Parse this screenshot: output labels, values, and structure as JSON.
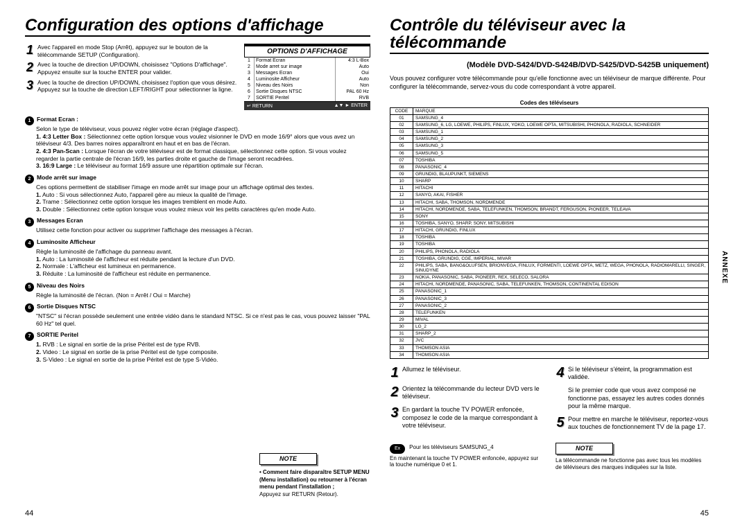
{
  "annexe": "ANNEXE",
  "pages": {
    "left": "44",
    "right": "45"
  },
  "left": {
    "title": "Configuration des options d'affichage",
    "steps": [
      "Avec l'appareil en mode Stop (Arrêt), appuyez sur le bouton de la télécommande SETUP (Configuration).",
      "Avec la touche de direction UP/DOWN, choisissez \"Options D'affichage\". Appuyez ensuite sur la touche ENTER pour valider.",
      "Avec la touche de direction UP/DOWN, choisissez l'option que vous désirez. Appuyez sur la touche de direction LEFT/RIGHT pour sélectionner la ligne."
    ],
    "panel": {
      "title": "OPTIONS D'AFFICHAGE",
      "rows": [
        {
          "n": "1",
          "label": "Format Ecran",
          "val": "4:3  L-Box"
        },
        {
          "n": "2",
          "label": "Mode arret sur image",
          "val": "Auto"
        },
        {
          "n": "3",
          "label": "Messages Ecran",
          "val": "Oui"
        },
        {
          "n": "4",
          "label": "Luminosite Afficheur",
          "val": "Auto"
        },
        {
          "n": "5",
          "label": "Niveau des Noirs",
          "val": "Non"
        },
        {
          "n": "6",
          "label": "Sortie Disques NTSC",
          "val": "PAL 60 Hz"
        },
        {
          "n": "7",
          "label": "SORTIE Peritel",
          "val": "RVB"
        }
      ],
      "ftr_left": "RETURN",
      "ftr_right": "ENTER"
    },
    "details": [
      {
        "n": "1",
        "title": "Format Ecran :",
        "body": "Selon le type de téléviseur, vous pouvez régler votre écran (réglage d'aspect).",
        "items": [
          {
            "h": "1. 4:3 Letter Box :",
            "t": "Sélectionnez cette option lorsque vous voulez visionner le DVD en mode 16/9° alors que vous avez un téléviseur 4/3. Des barres noires apparaîtront en haut et en bas de l'écran."
          },
          {
            "h": "2. 4:3 Pan-Scan :",
            "t": "Lorsque l'écran de votre téléviseur est de format classique, sélectionnez cette option. Si vous voulez regarder la partie centrale de l'écran 16/9, les parties droite et gauche de l'image seront recadrées."
          },
          {
            "h": "3. 16:9 Large :",
            "t": "Le téléviseur au format 16/9 assure une répartition optimale sur l'écran."
          }
        ]
      },
      {
        "n": "2",
        "title": "Mode arrêt sur image",
        "body": "Ces options permettent de stabiliser l'image en mode arrêt sur image pour un affichage optimal des textes.",
        "items": [
          {
            "h": "1.",
            "t": "Auto : Si vous sélectionnez Auto, l'appareil gère au mieux la qualité de l'image."
          },
          {
            "h": "2.",
            "t": "Trame : Sélectionnez cette option lorsque les images tremblent en mode Auto."
          },
          {
            "h": "3.",
            "t": "Double : Sélectionnez cette option lorsque vous voulez mieux voir les petits caractères qu'en mode Auto."
          }
        ]
      },
      {
        "n": "3",
        "title": "Messages Ecran",
        "body": "Utilisez cette fonction pour activer ou supprimer l'affichage des messages à l'écran."
      },
      {
        "n": "4",
        "title": "Luminosite Afficheur",
        "body": "Règle la luminosité de l'affichage du panneau avant.",
        "items": [
          {
            "h": "1.",
            "t": "Auto : La luminosité de l'afficheur est réduite pendant la lecture d'un DVD."
          },
          {
            "h": "2.",
            "t": "Normale : L'afficheur est lumineux en permanence."
          },
          {
            "h": "3.",
            "t": "Réduite : La luminosité de l'afficheur est réduite en permanence."
          }
        ]
      },
      {
        "n": "5",
        "title": "Niveau des Noirs",
        "body": "Règle la luminosité de l'écran. (Non = Arrêt / Oui = Marche)"
      },
      {
        "n": "6",
        "title": "Sortie Disques NTSC",
        "body": "\"NTSC\" si l'écran possède seulement une entrée vidéo dans le standard NTSC. Si ce n'est pas le cas, vous pouvez laisser \"PAL 60 Hz\" tel quel."
      },
      {
        "n": "7",
        "title": "SORTIE Peritel",
        "items": [
          {
            "h": "1.",
            "t": "RVB : Le signal en sortie de la prise Péritel est de type RVB."
          },
          {
            "h": "2.",
            "t": "Video : Le signal en sortie de la prise Péritel est de type composite."
          },
          {
            "h": "3.",
            "t": "S-Video : Le signal en sortie de la prise Péritel est de type S-Vidéo."
          }
        ]
      }
    ],
    "note": {
      "label": "NOTE",
      "body": "• Comment faire disparaître SETUP MENU (Menu installation) ou retourner à l'écran menu pendant l'installation ;",
      "tail": "Appuyez sur RETURN (Retour)."
    }
  },
  "right": {
    "title": "Contrôle du téléviseur avec la télécommande",
    "model": "(Modèle DVD-S424/DVD-S424B/DVD-S425/DVD-S425B uniquement)",
    "intro": "Vous pouvez configurer votre télécommande pour qu'elle fonctionne avec un téléviseur de marque différente. Pour configurer la télécommande, servez-vous du code correspondant à votre appareil.",
    "codes_title": "Codes des téléviseurs",
    "code_hdr": "CODE",
    "brand_hdr": "MARQUE",
    "codes": [
      {
        "c": "01",
        "m": "SAMSUNG_4"
      },
      {
        "c": "02",
        "m": "SAMSUNG_6, LG, LOEWE, PHILIPS, FINLUX, YOKO, LOEWE OPTA, MITSUBISHI, PHONOLA, RADIOLA, SCHNEIDER"
      },
      {
        "c": "03",
        "m": "SAMSUNG_1"
      },
      {
        "c": "04",
        "m": "SAMSUNG_2"
      },
      {
        "c": "05",
        "m": "SAMSUNG_3"
      },
      {
        "c": "06",
        "m": "SAMSUNG_5"
      },
      {
        "c": "07",
        "m": "TOSHIBA"
      },
      {
        "c": "08",
        "m": "PANASONIC_4"
      },
      {
        "c": "09",
        "m": "GRUNDIG, BLAUPUNKT, SIEMENS"
      },
      {
        "c": "10",
        "m": "SHARP"
      },
      {
        "c": "11",
        "m": "HITACHI"
      },
      {
        "c": "12",
        "m": "SANYO, AKAI, FISHER"
      },
      {
        "c": "13",
        "m": "HITACHI, SABA, THOMSON, NORDMENDE"
      },
      {
        "c": "14",
        "m": "HITACHI, NORDMENDE, SABA, TELEFUNKEN, THOMSON, BRANDT, FERGUSON, PIONEER, TELEAVA"
      },
      {
        "c": "15",
        "m": "SONY"
      },
      {
        "c": "16",
        "m": "TOSHIBA, SANYO, SHARP, SONY, MITSUBISHI"
      },
      {
        "c": "17",
        "m": "HITACHI, GRUNDIG, FINLUX"
      },
      {
        "c": "18",
        "m": "TOSHIBA"
      },
      {
        "c": "19",
        "m": "TOSHIBA"
      },
      {
        "c": "20",
        "m": "PHILIPS, PHONOLA, RADIOLA"
      },
      {
        "c": "21",
        "m": "TOSHIBA, GRUNDIG, CGE, IMPERIAL, MIVAR"
      },
      {
        "c": "22",
        "m": "PHILIPS, SABA, BANG&OLUFSEN, BRIONVEGA, FINLUX, FORMENTI, LOEWE OPTA, METZ, WEGA, PHONOLA, RADIOMARELLI, SINGER, SINUDYNE"
      },
      {
        "c": "23",
        "m": "NOKIA, PANASONIC, SABA, PIONEER, REX, SELECO, SALORA"
      },
      {
        "c": "24",
        "m": "HITACHI, NORDMENDE, PANASONIC, SABA, TELEFUNKEN, THOMSON, CONTINENTAL EDISON"
      },
      {
        "c": "25",
        "m": "PANASONIC_1"
      },
      {
        "c": "26",
        "m": "PANASONIC_3"
      },
      {
        "c": "27",
        "m": "PANASONIC_2"
      },
      {
        "c": "28",
        "m": "TELEFUNKEN"
      },
      {
        "c": "29",
        "m": "MIVAL"
      },
      {
        "c": "30",
        "m": "LG_2"
      },
      {
        "c": "31",
        "m": "SHARP_2"
      },
      {
        "c": "32",
        "m": "JVC"
      },
      {
        "c": "33",
        "m": "THOMSON ASIA"
      },
      {
        "c": "34",
        "m": "THOMSON ASIA"
      }
    ],
    "stepsA": [
      {
        "n": "1",
        "t": "Allumez le téléviseur."
      },
      {
        "n": "2",
        "t": "Orientez la télécommande du lecteur DVD vers le téléviseur."
      },
      {
        "n": "3",
        "t": "En gardant la touche TV POWER enfoncée, composez le code de la marque correspondant à votre téléviseur."
      }
    ],
    "stepsB": [
      {
        "n": "4",
        "t": "Si le téléviseur s'éteint, la programmation est validée."
      },
      {
        "n": "",
        "t": "Si le premier code que vous avez composé ne fonctionne pas, essayez les autres codes donnés pour la même marque."
      },
      {
        "n": "5",
        "t": "Pour mettre en marche le téléviseur, reportez-vous aux touches de fonctionnement TV de la page 17."
      }
    ],
    "ex": {
      "badge": "Ex",
      "t1": "Pour les téléviseurs SAMSUNG_4",
      "t2": "En maintenant la touche TV POWER enfoncée, appuyez sur la touche numérique 0 et 1."
    },
    "note": {
      "label": "NOTE",
      "body": "La télécommande ne fonctionne pas avec tous les modèles de téléviseurs des marques indiquées sur la liste."
    }
  }
}
